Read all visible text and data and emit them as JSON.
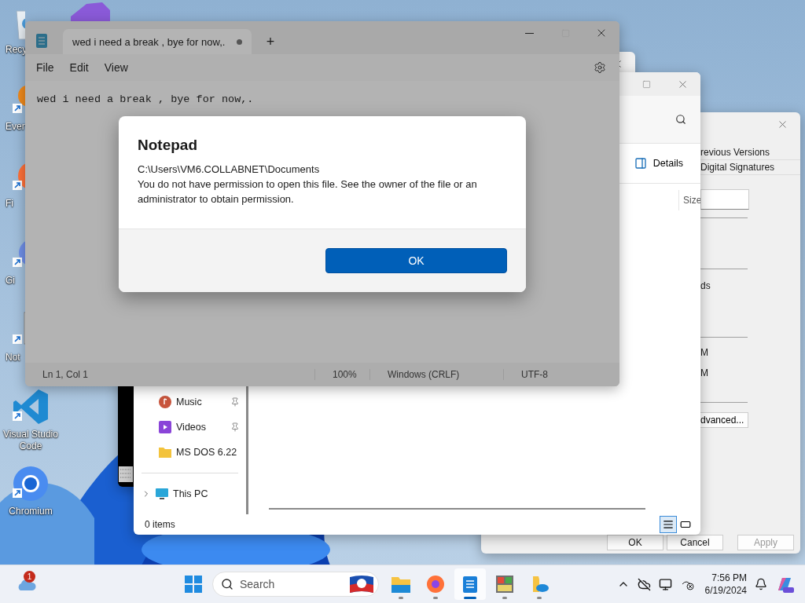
{
  "desktop_icons": [
    {
      "kind": "recycle",
      "label": "Recy",
      "covered": true
    },
    {
      "kind": "everything",
      "label": "Ever",
      "covered": true
    },
    {
      "kind": "firefox",
      "label": "Fi",
      "covered": true
    },
    {
      "kind": "git",
      "label": "Gi",
      "covered": true
    },
    {
      "kind": "notepad",
      "label": "Not",
      "covered": true
    },
    {
      "kind": "vscode",
      "label": "Visual Studio Code",
      "covered": false
    },
    {
      "kind": "chromium",
      "label": "Chromium",
      "covered": false
    }
  ],
  "notepad": {
    "tab_title": "wed i need a break , bye for now,.",
    "unsaved": true,
    "new_tab": "+",
    "menu": [
      "File",
      "Edit",
      "View"
    ],
    "text": "wed i need a break , bye for now,.",
    "status": [
      "Ln 1, Col 1",
      "100%",
      "Windows (CRLF)",
      "UTF-8"
    ]
  },
  "dialog": {
    "title": "Notepad",
    "path": "C:\\Users\\VM6.COLLABNET\\Documents",
    "message": "You do not have permission to open this file.  See the owner of the file or an administrator to obtain permission.",
    "button": "OK"
  },
  "explorer": {
    "toolbar_button": "Details",
    "column": "Size",
    "nav": [
      {
        "kind": "music",
        "label": "Music",
        "pinned": true
      },
      {
        "kind": "videos",
        "label": "Videos",
        "pinned": true
      },
      {
        "kind": "folder",
        "label": "MS DOS 6.22",
        "pinned": false
      },
      {
        "kind": "pc",
        "label": "This PC",
        "pinned": false
      }
    ],
    "status": "0 items",
    "view_buttons": [
      {
        "kind": "details",
        "selected": true
      },
      {
        "kind": "tiles",
        "selected": false
      }
    ]
  },
  "properties": {
    "tabs": [
      "revious Versions",
      "Digital Signatures"
    ],
    "labels": [
      "ds",
      "M",
      "M"
    ],
    "advanced_button": "dvanced...",
    "buttons": [
      {
        "label": "OK",
        "disabled": false
      },
      {
        "label": "Cancel",
        "disabled": false
      },
      {
        "label": "Apply",
        "disabled": true
      }
    ]
  },
  "taskbar": {
    "weather_badge": "1",
    "search_placeholder": "Search",
    "apps": [
      {
        "kind": "folder",
        "running": true,
        "selected": false
      },
      {
        "kind": "firefox",
        "running": true,
        "selected": false
      },
      {
        "kind": "notepad",
        "running": true,
        "selected": true
      },
      {
        "kind": "app",
        "running": true,
        "selected": false
      },
      {
        "kind": "cloud-folder",
        "running": true,
        "selected": false
      }
    ],
    "time": "7:56 PM",
    "date": "6/19/2024"
  }
}
